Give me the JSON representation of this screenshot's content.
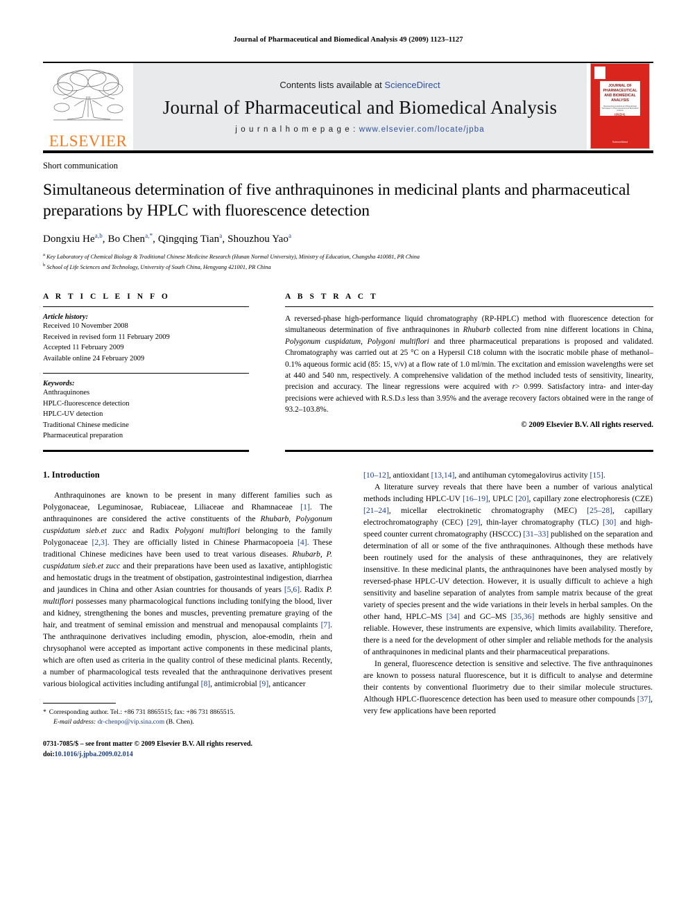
{
  "running_head": "Journal of Pharmaceutical and Biomedical Analysis 49 (2009) 1123–1127",
  "masthead": {
    "contents_prefix": "Contents lists available at ",
    "sciencedirect": "ScienceDirect",
    "journal_name": "Journal of Pharmaceutical and Biomedical Analysis",
    "homepage_prefix": "j o u r n a l   h o m e p a g e :   ",
    "homepage_url": "www.elsevier.com/locate/jpba",
    "publisher": "ELSEVIER",
    "cover": {
      "title_line1": "JOURNAL OF",
      "title_line2": "PHARMACEUTICAL",
      "title_line3": "AND BIOMEDICAL",
      "title_line4": "ANALYSIS",
      "subtitle": "Representing Analytical and Bioanalytical Techniques in Pharmaceutical and Biomedical Analysis",
      "logo": "IBPS",
      "footer": "ScienceDirect"
    },
    "accent_red": "#d9251d",
    "accent_orange": "#F47C20",
    "link_blue": "#2b4f9e"
  },
  "article": {
    "doctype": "Short communication",
    "title": "Simultaneous determination of five anthraquinones in medicinal plants and pharmaceutical preparations by HPLC with fluorescence detection",
    "authors": [
      {
        "name": "Dongxiu He",
        "marks": "a,b",
        "sep": ", "
      },
      {
        "name": "Bo Chen",
        "marks": "a,*",
        "sep": ", "
      },
      {
        "name": "Qingqing Tian",
        "marks": "a",
        "sep": ", "
      },
      {
        "name": "Shouzhou Yao",
        "marks": "a",
        "sep": ""
      }
    ],
    "affiliations": [
      {
        "mark": "a",
        "text": "Key Laboratory of Chemical Biology & Traditional Chinese Medicine Research (Hunan Normal University), Ministry of Education, Changsha 410081, PR China"
      },
      {
        "mark": "b",
        "text": "School of Life Sciences and Technology, University of South China, Hengyang 421001, PR China"
      }
    ]
  },
  "article_info": {
    "heading": "A R T I C L E    I N F O",
    "history_label": "Article history:",
    "history": [
      "Received 10 November 2008",
      "Received in revised form 11 February 2009",
      "Accepted 11 February 2009",
      "Available online 24 February 2009"
    ],
    "keywords_label": "Keywords:",
    "keywords": [
      "Anthraquinones",
      "HPLC-fluorescence detection",
      "HPLC-UV detection",
      "Traditional Chinese medicine",
      "Pharmaceutical preparation"
    ]
  },
  "abstract": {
    "heading": "A B S T R A C T",
    "segments": [
      {
        "t": "A reversed-phase high-performance liquid chromatography (RP-HPLC) method with fluorescence detection for simultaneous determination of five anthraquinones in ",
        "i": false
      },
      {
        "t": "Rhubarb",
        "i": true
      },
      {
        "t": " collected from nine different locations in China, ",
        "i": false
      },
      {
        "t": "Polygonum cuspidatum",
        "i": true
      },
      {
        "t": ", ",
        "i": false
      },
      {
        "t": "Polygoni multiflori",
        "i": true
      },
      {
        "t": " and three pharmaceutical preparations is proposed and validated. Chromatography was carried out at 25 °C on a Hypersil C18 column with the isocratic mobile phase of methanol–0.1% aqueous formic acid (85: 15, v/v) at a flow rate of 1.0 ml/min. The excitation and emission wavelengths were set at 440 and 540 nm, respectively. A comprehensive validation of the method included tests of sensitivity, linearity, precision and accuracy. The linear regressions were acquired with ",
        "i": false
      },
      {
        "t": "r",
        "i": true
      },
      {
        "t": "> 0.999. Satisfactory intra- and inter-day precisions were achieved with R.S.D.s less than 3.95% and the average recovery factors obtained were in the range of 93.2–103.8%.",
        "i": false
      }
    ],
    "copyright": "© 2009 Elsevier B.V. All rights reserved."
  },
  "body": {
    "section_heading": "1.  Introduction",
    "left_paragraphs": [
      [
        {
          "t": "Anthraquinones are known to be present in many different families such as Polygonaceae, Leguminosae, Rubiaceae, Liliaceae and Rhamnaceae "
        },
        {
          "t": "[1]",
          "ref": true
        },
        {
          "t": ". The anthraquinones are considered the active constituents of the "
        },
        {
          "t": "Rhubarb, Polygonum cuspidatum sieb.et zucc",
          "i": true
        },
        {
          "t": " and Radix "
        },
        {
          "t": "Polygoni multiflori",
          "i": true
        },
        {
          "t": " belonging to the family Polygonaceae "
        },
        {
          "t": "[2,3]",
          "ref": true
        },
        {
          "t": ". They are officially listed in Chinese Pharmacopoeia "
        },
        {
          "t": "[4]",
          "ref": true
        },
        {
          "t": ". These traditional Chinese medicines have been used to treat various diseases. "
        },
        {
          "t": "Rhubarb, P. cuspidatum sieb.et zucc",
          "i": true
        },
        {
          "t": " and their preparations have been used as laxative, antiphlogistic and hemostatic drugs in the treatment of obstipation, gastrointestinal indigestion, diarrhea and jaundices in China and other Asian countries for thousands of years "
        },
        {
          "t": "[5,6]",
          "ref": true
        },
        {
          "t": ". Radix "
        },
        {
          "t": "P. multiflori",
          "i": true
        },
        {
          "t": " possesses many pharmacological functions including tonifying the blood, liver and kidney, strengthening the bones and muscles, preventing premature graying of the hair, and treatment of seminal emission and menstrual and menopausal complaints "
        },
        {
          "t": "[7]",
          "ref": true
        },
        {
          "t": ". The anthraquinone derivatives including emodin, physcion, aloe-emodin, rhein and chrysophanol were accepted as important active components in these medicinal plants, which are often used as criteria in the quality control of these medicinal plants. Recently, a number of pharmacological tests revealed that the anthraquinone derivatives present various biological activities including antifungal "
        },
        {
          "t": "[8]",
          "ref": true
        },
        {
          "t": ", antimicrobial "
        },
        {
          "t": "[9]",
          "ref": true
        },
        {
          "t": ", anticancer"
        }
      ]
    ],
    "right_paragraphs": [
      [
        {
          "t": "[10–12]",
          "ref": true
        },
        {
          "t": ", antioxidant "
        },
        {
          "t": "[13,14]",
          "ref": true
        },
        {
          "t": ", and antihuman cytomegalovirus activity "
        },
        {
          "t": "[15]",
          "ref": true
        },
        {
          "t": "."
        }
      ],
      [
        {
          "t": "A literature survey reveals that there have been a number of various analytical methods including HPLC-UV "
        },
        {
          "t": "[16–19]",
          "ref": true
        },
        {
          "t": ", UPLC "
        },
        {
          "t": "[20]",
          "ref": true
        },
        {
          "t": ", capillary zone electrophoresis (CZE) "
        },
        {
          "t": "[21–24]",
          "ref": true
        },
        {
          "t": ", micellar electrokinetic chromatography (MEC) "
        },
        {
          "t": "[25–28]",
          "ref": true
        },
        {
          "t": ", capillary electrochromatography (CEC) "
        },
        {
          "t": "[29]",
          "ref": true
        },
        {
          "t": ", thin-layer chromatography (TLC) "
        },
        {
          "t": "[30]",
          "ref": true
        },
        {
          "t": " and high-speed counter current chromatography (HSCCC) "
        },
        {
          "t": "[31–33]",
          "ref": true
        },
        {
          "t": " published on the separation and determination of all or some of the five anthraquinones. Although these methods have been routinely used for the analysis of these anthraquinones, they are relatively insensitive. In these medicinal plants, the anthraquinones have been analysed mostly by reversed-phase HPLC-UV detection. However, it is usually difficult to achieve a high sensitivity and baseline separation of analytes from sample matrix because of the great variety of species present and the wide variations in their levels in herbal samples. On the other hand, HPLC–MS "
        },
        {
          "t": "[34]",
          "ref": true
        },
        {
          "t": " and GC–MS "
        },
        {
          "t": "[35,36]",
          "ref": true
        },
        {
          "t": " methods are highly sensitive and reliable. However, these instruments are expensive, which limits availability. Therefore, there is a need for the development of other simpler and reliable methods for the analysis of anthraquinones in medicinal plants and their pharmaceutical preparations."
        }
      ],
      [
        {
          "t": "In general, fluorescence detection is sensitive and selective. The five anthraquinones are known to possess natural fluorescence, but it is difficult to analyse and determine their contents by conventional fluorimetry due to their similar molecule structures. Although HPLC-fluorescence detection has been used to measure other compounds "
        },
        {
          "t": "[37]",
          "ref": true
        },
        {
          "t": ", very few applications have been reported"
        }
      ]
    ]
  },
  "footnote": {
    "star": "*",
    "line1": "Corresponding author. Tel.: +86 731 8865515; fax: +86 731 8865515.",
    "email_label": "E-mail address:",
    "email": "dr-chenpo@vip.sina.com",
    "email_suffix": " (B. Chen)."
  },
  "imprint": {
    "line1": "0731-7085/$ – see front matter © 2009 Elsevier B.V. All rights reserved.",
    "doi_label": "doi:",
    "doi_value": "10.1016/j.jpba.2009.02.014"
  }
}
